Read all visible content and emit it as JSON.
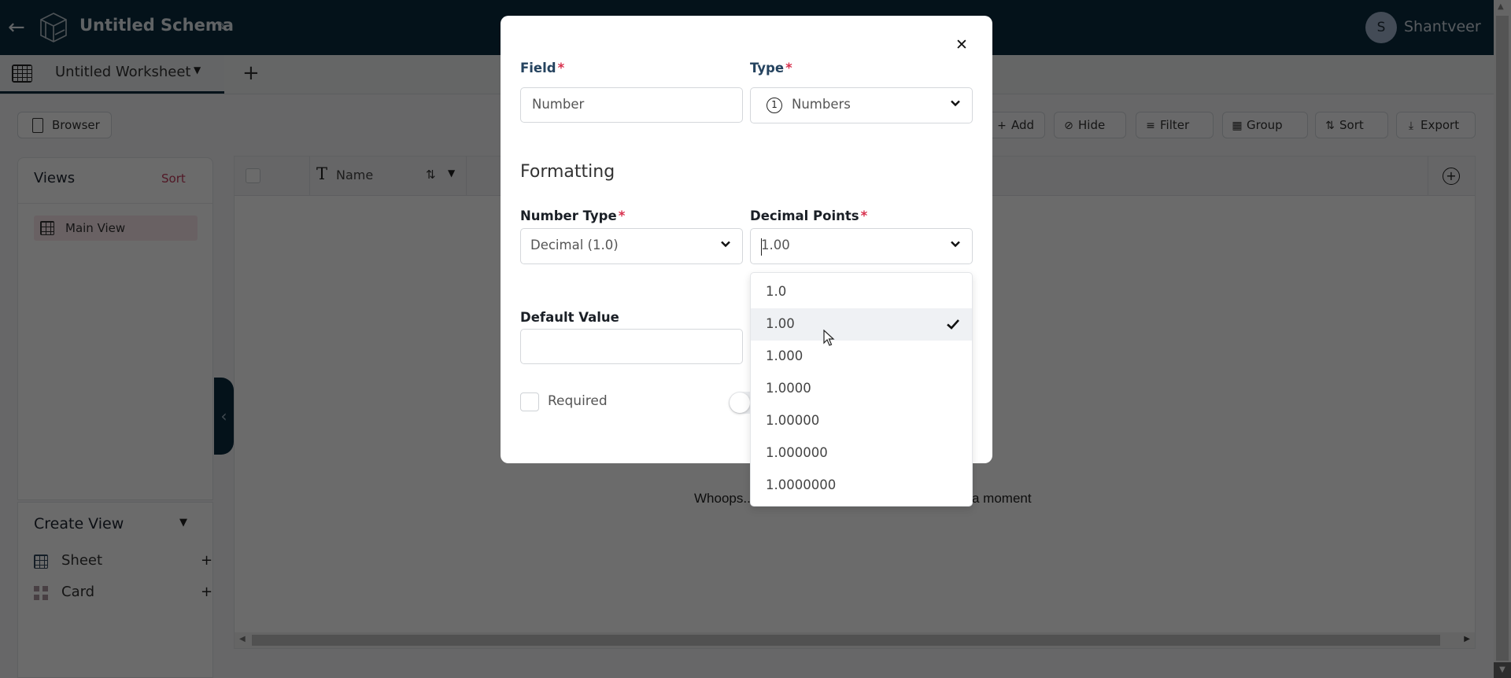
{
  "header": {
    "title": "Untitled Schema",
    "user_initial": "S",
    "user_name": "Shantveer"
  },
  "tabs": [
    {
      "label": "Untitled Worksheet",
      "active": true
    }
  ],
  "toolbar": {
    "browser_label": "Browser",
    "buttons": [
      {
        "label": "Add",
        "icon": "plus-icon"
      },
      {
        "label": "Hide",
        "icon": "eye-off-icon"
      },
      {
        "label": "Filter",
        "icon": "filter-icon"
      },
      {
        "label": "Group",
        "icon": "group-icon"
      },
      {
        "label": "Sort",
        "icon": "sort-icon"
      },
      {
        "label": "Export",
        "icon": "download-icon"
      }
    ]
  },
  "sidebar": {
    "views_title": "Views",
    "views_sort_label": "Sort",
    "views": [
      {
        "label": "Main View",
        "selected": true
      }
    ],
    "create_view_title": "Create View",
    "create_items": [
      {
        "label": "Sheet",
        "icon": "sheet-icon"
      },
      {
        "label": "Card",
        "icon": "card-icon"
      }
    ]
  },
  "grid": {
    "columns": [
      {
        "label": "Name",
        "type_icon": "text-type-icon"
      }
    ],
    "empty_message_visible_start": "Whoops...",
    "empty_message_visible_end": "a moment"
  },
  "modal": {
    "field_label": "Field",
    "field_value": "Number",
    "type_label": "Type",
    "type_value": "Numbers",
    "formatting_title": "Formatting",
    "number_type_label": "Number Type",
    "number_type_value": "Decimal (1.0)",
    "decimal_points_label": "Decimal Points",
    "decimal_points_value": "1.00",
    "default_value_label": "Default Value",
    "default_value": "",
    "required_label": "Required",
    "required_checked": false,
    "required_marker": "*"
  },
  "decimal_dropdown": {
    "options": [
      "1.0",
      "1.00",
      "1.000",
      "1.0000",
      "1.00000",
      "1.000000",
      "1.0000000"
    ],
    "selected": "1.00"
  },
  "colors": {
    "header_bg": "#0b2b3f",
    "required_red": "#d8314e",
    "sort_link": "#c23b5c",
    "selected_view_bg": "#fbe7ec"
  }
}
